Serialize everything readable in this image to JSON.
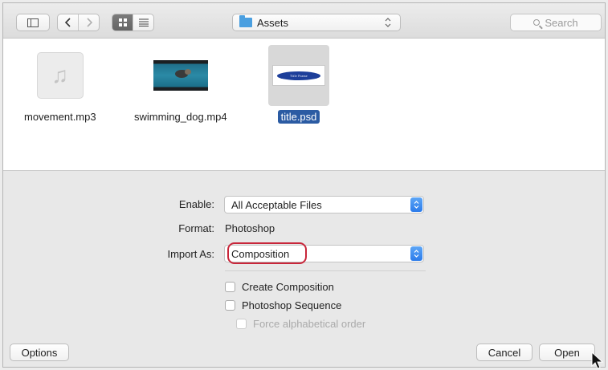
{
  "toolbar": {
    "sidebar_toggle_icon": "sidebar-icon",
    "back_icon": "chevron-left-icon",
    "forward_icon": "chevron-right-icon",
    "grid_view_icon": "grid-icon",
    "list_view_icon": "list-icon",
    "location": "Assets",
    "search_placeholder": "Search"
  },
  "files": [
    {
      "name": "movement.mp3",
      "kind": "audio",
      "selected": false
    },
    {
      "name": "swimming_dog.mp4",
      "kind": "video",
      "selected": false
    },
    {
      "name": "title.psd",
      "kind": "image",
      "selected": true,
      "thumb_text": "Title Frame"
    }
  ],
  "form": {
    "enable_label": "Enable:",
    "enable_value": "All Acceptable Files",
    "format_label": "Format:",
    "format_value": "Photoshop",
    "import_as_label": "Import As:",
    "import_as_value": "Composition",
    "create_composition_label": "Create Composition",
    "photoshop_sequence_label": "Photoshop Sequence",
    "force_alpha_label": "Force alphabetical order"
  },
  "buttons": {
    "options": "Options",
    "cancel": "Cancel",
    "open": "Open"
  },
  "colors": {
    "selection": "#2b5ba3",
    "highlight_ring": "#c8263a",
    "folder": "#4a9fe0",
    "stepper": "#2b7bea"
  }
}
